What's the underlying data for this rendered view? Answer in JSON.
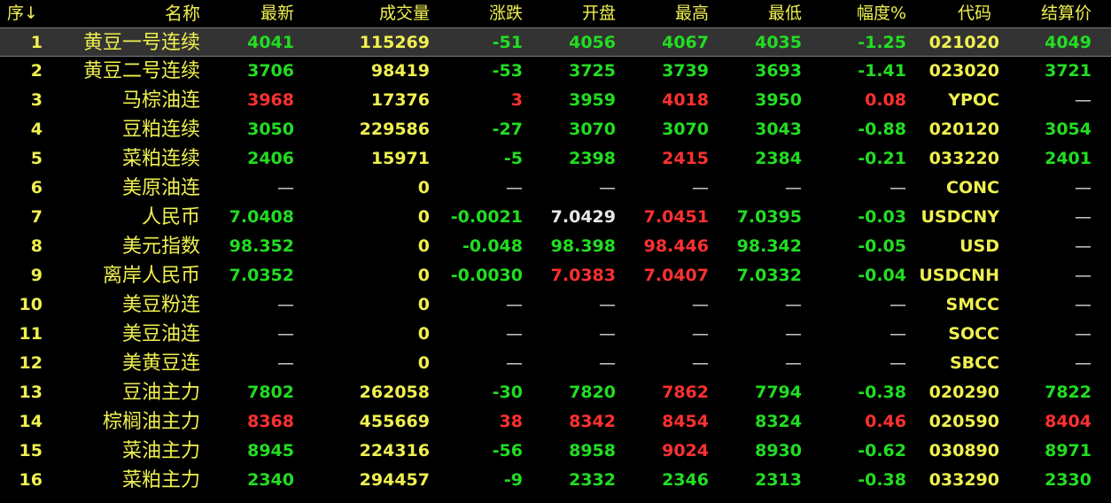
{
  "headers": {
    "seq": "序↓",
    "name": "名称",
    "last": "最新",
    "volume": "成交量",
    "change": "涨跌",
    "open": "开盘",
    "high": "最高",
    "low": "最低",
    "pct": "幅度%",
    "code": "代码",
    "settle": "结算价"
  },
  "colors": {
    "up": "#ff3030",
    "down": "#22dd22",
    "neutral": "#e8e8e8",
    "label": "#f0f050",
    "selected_row_bg": "#333333"
  },
  "rows": [
    {
      "seq": "1",
      "name": "黄豆一号连续",
      "last": "4041",
      "volume": "115269",
      "change": "-51",
      "open": "4056",
      "high": "4067",
      "low": "4035",
      "pct": "-1.25",
      "code": "021020",
      "settle": "4049",
      "selected": true
    },
    {
      "seq": "2",
      "name": "黄豆二号连续",
      "last": "3706",
      "volume": "98419",
      "change": "-53",
      "open": "3725",
      "high": "3739",
      "low": "3693",
      "pct": "-1.41",
      "code": "023020",
      "settle": "3721"
    },
    {
      "seq": "3",
      "name": "马棕油连",
      "last": "3968",
      "volume": "17376",
      "change": "3",
      "open": "3959",
      "high": "4018",
      "low": "3950",
      "pct": "0.08",
      "code": "YPOC",
      "settle": "—"
    },
    {
      "seq": "4",
      "name": "豆粕连续",
      "last": "3050",
      "volume": "229586",
      "change": "-27",
      "open": "3070",
      "high": "3070",
      "low": "3043",
      "pct": "-0.88",
      "code": "020120",
      "settle": "3054"
    },
    {
      "seq": "5",
      "name": "菜粕连续",
      "last": "2406",
      "volume": "15971",
      "change": "-5",
      "open": "2398",
      "high": "2415",
      "low": "2384",
      "pct": "-0.21",
      "code": "033220",
      "settle": "2401"
    },
    {
      "seq": "6",
      "name": "美原油连",
      "last": "—",
      "volume": "0",
      "change": "—",
      "open": "—",
      "high": "—",
      "low": "—",
      "pct": "—",
      "code": "CONC",
      "settle": "—"
    },
    {
      "seq": "7",
      "name": "人民币",
      "last": "7.0408",
      "volume": "0",
      "change": "-0.0021",
      "open": "7.0429",
      "high": "7.0451",
      "low": "7.0395",
      "pct": "-0.03",
      "code": "USDCNY",
      "settle": "—"
    },
    {
      "seq": "8",
      "name": "美元指数",
      "last": "98.352",
      "volume": "0",
      "change": "-0.048",
      "open": "98.398",
      "high": "98.446",
      "low": "98.342",
      "pct": "-0.05",
      "code": "USD",
      "settle": "—"
    },
    {
      "seq": "9",
      "name": "离岸人民币",
      "last": "7.0352",
      "volume": "0",
      "change": "-0.0030",
      "open": "7.0383",
      "high": "7.0407",
      "low": "7.0332",
      "pct": "-0.04",
      "code": "USDCNH",
      "settle": "—"
    },
    {
      "seq": "10",
      "name": "美豆粉连",
      "last": "—",
      "volume": "0",
      "change": "—",
      "open": "—",
      "high": "—",
      "low": "—",
      "pct": "—",
      "code": "SMCC",
      "settle": "—"
    },
    {
      "seq": "11",
      "name": "美豆油连",
      "last": "—",
      "volume": "0",
      "change": "—",
      "open": "—",
      "high": "—",
      "low": "—",
      "pct": "—",
      "code": "SOCC",
      "settle": "—"
    },
    {
      "seq": "12",
      "name": "美黄豆连",
      "last": "—",
      "volume": "0",
      "change": "—",
      "open": "—",
      "high": "—",
      "low": "—",
      "pct": "—",
      "code": "SBCC",
      "settle": "—"
    },
    {
      "seq": "13",
      "name": "豆油主力",
      "last": "7802",
      "volume": "262058",
      "change": "-30",
      "open": "7820",
      "high": "7862",
      "low": "7794",
      "pct": "-0.38",
      "code": "020290",
      "settle": "7822"
    },
    {
      "seq": "14",
      "name": "棕榈油主力",
      "last": "8368",
      "volume": "455669",
      "change": "38",
      "open": "8342",
      "high": "8454",
      "low": "8324",
      "pct": "0.46",
      "code": "020590",
      "settle": "8404"
    },
    {
      "seq": "15",
      "name": "菜油主力",
      "last": "8945",
      "volume": "224316",
      "change": "-56",
      "open": "8958",
      "high": "9024",
      "low": "8930",
      "pct": "-0.62",
      "code": "030890",
      "settle": "8971"
    },
    {
      "seq": "16",
      "name": "菜粕主力",
      "last": "2340",
      "volume": "294457",
      "change": "-9",
      "open": "2332",
      "high": "2346",
      "low": "2313",
      "pct": "-0.38",
      "code": "033290",
      "settle": "2330"
    }
  ]
}
